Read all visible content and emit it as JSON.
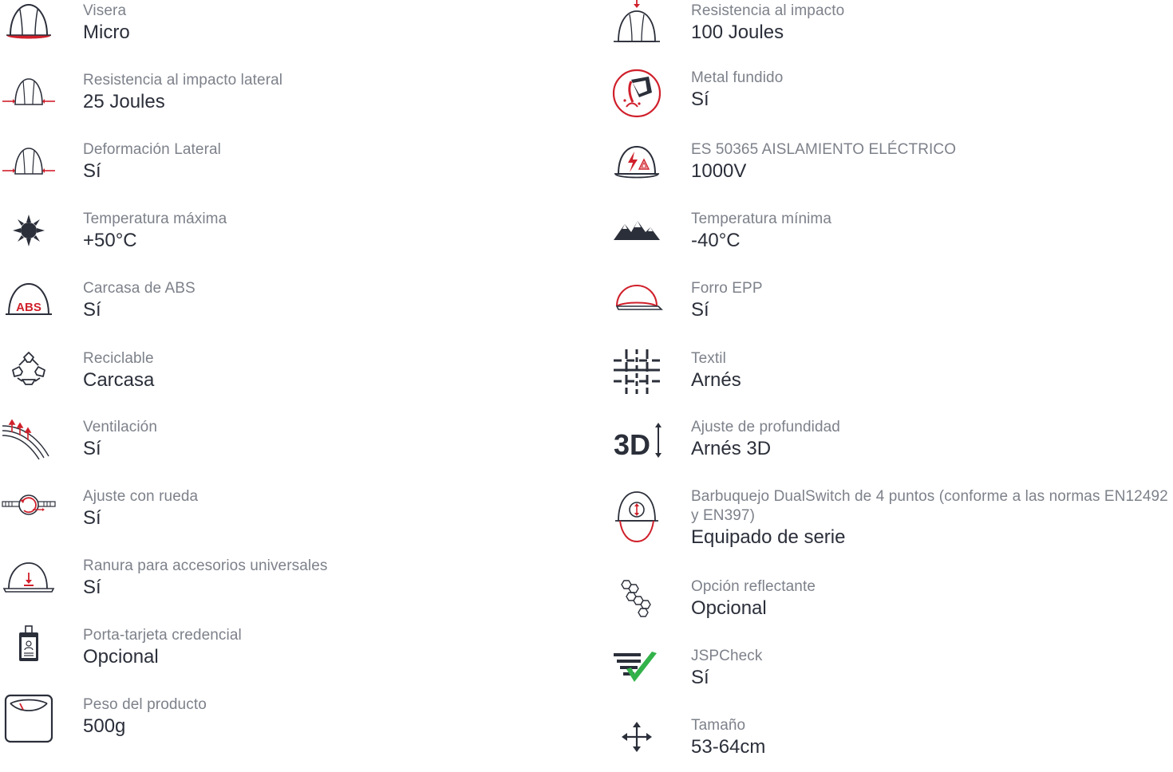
{
  "left": [
    {
      "icon": "visor-helmet-icon",
      "label": "Visera",
      "value": "Micro"
    },
    {
      "icon": "side-impact-icon",
      "label": "Resistencia al impacto lateral",
      "value": "25 Joules"
    },
    {
      "icon": "side-deformation-icon",
      "label": "Deformación Lateral",
      "value": "Sí"
    },
    {
      "icon": "sun-icon",
      "label": "Temperatura máxima",
      "value": "+50°C"
    },
    {
      "icon": "abs-shell-icon",
      "label": "Carcasa de ABS",
      "value": "Sí"
    },
    {
      "icon": "recycle-icon",
      "label": "Reciclable",
      "value": "Carcasa"
    },
    {
      "icon": "ventilation-icon",
      "label": "Ventilación",
      "value": "Sí"
    },
    {
      "icon": "wheel-ratchet-icon",
      "label": "Ajuste con rueda",
      "value": "Sí"
    },
    {
      "icon": "accessory-slot-icon",
      "label": "Ranura para accesorios universales",
      "value": "Sí"
    },
    {
      "icon": "badge-holder-icon",
      "label": "Porta-tarjeta credencial",
      "value": "Opcional"
    },
    {
      "icon": "weight-scale-icon",
      "label": "Peso del producto",
      "value": "500g"
    }
  ],
  "right": [
    {
      "icon": "impact-icon",
      "label": "Resistencia al impacto",
      "value": "100 Joules"
    },
    {
      "icon": "molten-metal-icon",
      "label": "Metal fundido",
      "value": "Sí"
    },
    {
      "icon": "electrical-insulation-icon",
      "label": "ES 50365 AISLAMIENTO ELÉCTRICO",
      "value": "1000V"
    },
    {
      "icon": "mountains-icon",
      "label": "Temperatura mínima",
      "value": "-40°C"
    },
    {
      "icon": "epp-liner-icon",
      "label": "Forro EPP",
      "value": "Sí"
    },
    {
      "icon": "textile-icon",
      "label": "Textil",
      "value": "Arnés"
    },
    {
      "icon": "depth-adjust-3d-icon",
      "label": "Ajuste de profundidad",
      "value": "Arnés 3D"
    },
    {
      "icon": "chinstrap-icon",
      "label": "Barbuquejo DualSwitch de 4 puntos (conforme a las normas EN12492 y EN397)",
      "value": "Equipado de serie"
    },
    {
      "icon": "hexagons-icon",
      "label": "Opción reflectante",
      "value": "Opcional"
    },
    {
      "icon": "check-icon",
      "label": "JSPCheck",
      "value": "Sí"
    },
    {
      "icon": "move-arrows-icon",
      "label": "Tamaño",
      "value": "53-64cm"
    }
  ],
  "colors": {
    "accent": "#d0202b",
    "navy": "#2b2f3a",
    "label": "#7d818a",
    "check": "#33b24a"
  }
}
